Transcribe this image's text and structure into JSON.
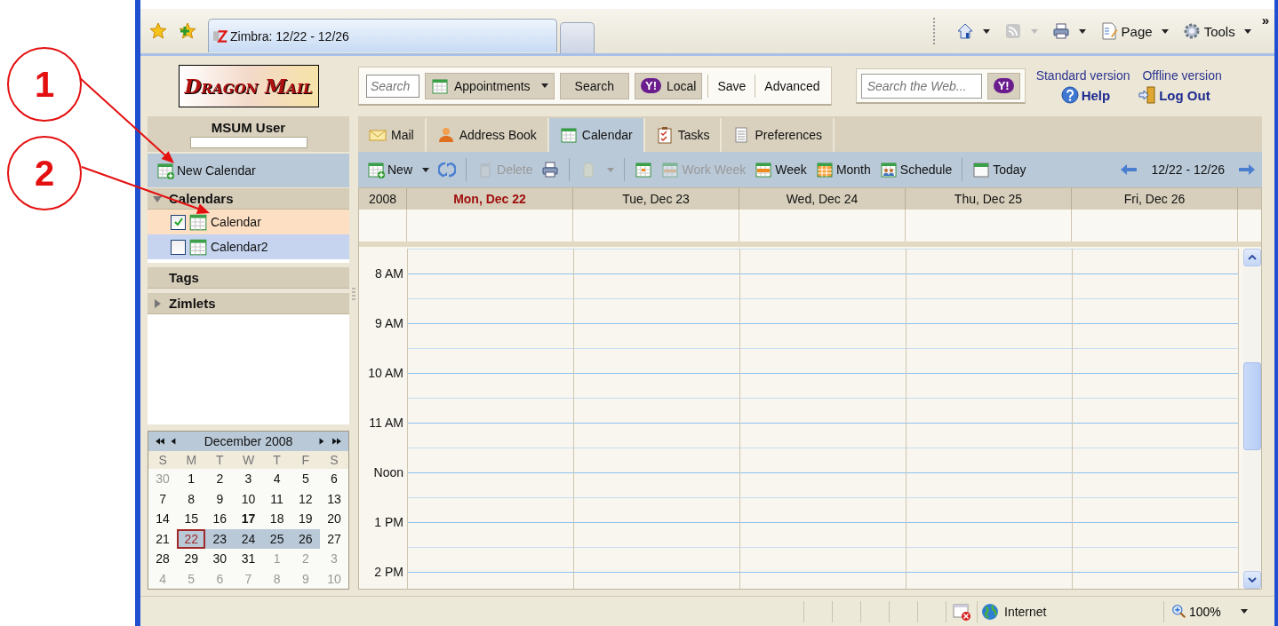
{
  "annotations": [
    {
      "label": "1"
    },
    {
      "label": "2"
    }
  ],
  "browser": {
    "tab_title": "Zimbra: 12/22 - 12/26",
    "commands": [
      {
        "kind": "home",
        "dropdown": true,
        "disabled": false
      },
      {
        "kind": "feeds",
        "dropdown": true,
        "disabled": true
      },
      {
        "kind": "print",
        "dropdown": true,
        "disabled": false
      },
      {
        "kind": "page",
        "label": "Page",
        "dropdown": true,
        "disabled": false
      },
      {
        "kind": "tools",
        "label": "Tools",
        "dropdown": true,
        "disabled": false
      }
    ],
    "overflow": "»"
  },
  "header": {
    "logo": "Dragon Mail",
    "search": {
      "placeholder": "Search",
      "type": "Appointments",
      "button": "Search",
      "local": {
        "mark": "Y!",
        "label": "Local"
      },
      "links": [
        "Save",
        "Advanced"
      ]
    },
    "web_search": {
      "placeholder": "Search the Web...",
      "mark": "Y!"
    },
    "links": [
      "Standard version",
      "Offline version"
    ],
    "actions": [
      {
        "kind": "help",
        "label": "Help"
      },
      {
        "kind": "logout",
        "label": "Log Out"
      }
    ]
  },
  "sidebar": {
    "user": "MSUM User",
    "new_calendar": "New Calendar",
    "sections": [
      {
        "kind": "tree",
        "label": "Calendars",
        "expanded": true,
        "items": [
          {
            "label": "Calendar",
            "checked": true,
            "color": "#fde0c4"
          },
          {
            "label": "Calendar2",
            "checked": false,
            "color": "#c6d4f0"
          }
        ]
      },
      {
        "kind": "header",
        "label": "Tags"
      },
      {
        "kind": "tree",
        "label": "Zimlets",
        "expanded": false
      }
    ]
  },
  "mini_calendar": {
    "title": "December 2008",
    "weekdays": [
      "S",
      "M",
      "T",
      "W",
      "T",
      "F",
      "S"
    ],
    "weeks": [
      [
        {
          "label": "30",
          "muted": true,
          "today": false,
          "selected": false,
          "focused": false
        },
        {
          "label": "1",
          "muted": false,
          "today": false,
          "selected": false,
          "focused": false
        },
        {
          "label": "2",
          "muted": false,
          "today": false,
          "selected": false,
          "focused": false
        },
        {
          "label": "3",
          "muted": false,
          "today": false,
          "selected": false,
          "focused": false
        },
        {
          "label": "4",
          "muted": false,
          "today": false,
          "selected": false,
          "focused": false
        },
        {
          "label": "5",
          "muted": false,
          "today": false,
          "selected": false,
          "focused": false
        },
        {
          "label": "6",
          "muted": false,
          "today": false,
          "selected": false,
          "focused": false
        }
      ],
      [
        {
          "label": "7",
          "muted": false,
          "today": false,
          "selected": false,
          "focused": false
        },
        {
          "label": "8",
          "muted": false,
          "today": false,
          "selected": false,
          "focused": false
        },
        {
          "label": "9",
          "muted": false,
          "today": false,
          "selected": false,
          "focused": false
        },
        {
          "label": "10",
          "muted": false,
          "today": false,
          "selected": false,
          "focused": false
        },
        {
          "label": "11",
          "muted": false,
          "today": false,
          "selected": false,
          "focused": false
        },
        {
          "label": "12",
          "muted": false,
          "today": false,
          "selected": false,
          "focused": false
        },
        {
          "label": "13",
          "muted": false,
          "today": false,
          "selected": false,
          "focused": false
        }
      ],
      [
        {
          "label": "14",
          "muted": false,
          "today": false,
          "selected": false,
          "focused": false
        },
        {
          "label": "15",
          "muted": false,
          "today": false,
          "selected": false,
          "focused": false
        },
        {
          "label": "16",
          "muted": false,
          "today": false,
          "selected": false,
          "focused": false
        },
        {
          "label": "17",
          "muted": false,
          "today": true,
          "selected": false,
          "focused": false
        },
        {
          "label": "18",
          "muted": false,
          "today": false,
          "selected": false,
          "focused": false
        },
        {
          "label": "19",
          "muted": false,
          "today": false,
          "selected": false,
          "focused": false
        },
        {
          "label": "20",
          "muted": false,
          "today": false,
          "selected": false,
          "focused": false
        }
      ],
      [
        {
          "label": "21",
          "muted": false,
          "today": false,
          "selected": false,
          "focused": false
        },
        {
          "label": "22",
          "muted": false,
          "today": false,
          "selected": true,
          "focused": true
        },
        {
          "label": "23",
          "muted": false,
          "today": false,
          "selected": true,
          "focused": false
        },
        {
          "label": "24",
          "muted": false,
          "today": false,
          "selected": true,
          "focused": false
        },
        {
          "label": "25",
          "muted": false,
          "today": false,
          "selected": true,
          "focused": false
        },
        {
          "label": "26",
          "muted": false,
          "today": false,
          "selected": true,
          "focused": false
        },
        {
          "label": "27",
          "muted": false,
          "today": false,
          "selected": false,
          "focused": false
        }
      ],
      [
        {
          "label": "28",
          "muted": false,
          "today": false,
          "selected": false,
          "focused": false
        },
        {
          "label": "29",
          "muted": false,
          "today": false,
          "selected": false,
          "focused": false
        },
        {
          "label": "30",
          "muted": false,
          "today": false,
          "selected": false,
          "focused": false
        },
        {
          "label": "31",
          "muted": false,
          "today": false,
          "selected": false,
          "focused": false
        },
        {
          "label": "1",
          "muted": true,
          "today": false,
          "selected": false,
          "focused": false
        },
        {
          "label": "2",
          "muted": true,
          "today": false,
          "selected": false,
          "focused": false
        },
        {
          "label": "3",
          "muted": true,
          "today": false,
          "selected": false,
          "focused": false
        }
      ],
      [
        {
          "label": "4",
          "muted": true,
          "today": false,
          "selected": false,
          "focused": false
        },
        {
          "label": "5",
          "muted": true,
          "today": false,
          "selected": false,
          "focused": false
        },
        {
          "label": "6",
          "muted": true,
          "today": false,
          "selected": false,
          "focused": false
        },
        {
          "label": "7",
          "muted": true,
          "today": false,
          "selected": false,
          "focused": false
        },
        {
          "label": "8",
          "muted": true,
          "today": false,
          "selected": false,
          "focused": false
        },
        {
          "label": "9",
          "muted": true,
          "today": false,
          "selected": false,
          "focused": false
        },
        {
          "label": "10",
          "muted": true,
          "today": false,
          "selected": false,
          "focused": false
        }
      ]
    ]
  },
  "app_tabs": [
    {
      "kind": "mail",
      "label": "Mail",
      "selected": false
    },
    {
      "kind": "contacts",
      "label": "Address Book",
      "selected": false
    },
    {
      "kind": "calendar",
      "label": "Calendar",
      "selected": true
    },
    {
      "kind": "tasks",
      "label": "Tasks",
      "selected": false
    },
    {
      "kind": "preferences",
      "label": "Preferences",
      "selected": false
    }
  ],
  "toolbar": {
    "items": [
      {
        "kind": "new",
        "label": "New",
        "dropdown": true,
        "disabled": false
      },
      {
        "kind": "refresh",
        "disabled": false
      },
      {
        "kind": "separator"
      },
      {
        "kind": "delete",
        "label": "Delete",
        "disabled": true
      },
      {
        "kind": "print",
        "disabled": false
      },
      {
        "kind": "separator"
      },
      {
        "kind": "tag",
        "dropdown": true,
        "disabled": true
      },
      {
        "kind": "separator"
      },
      {
        "kind": "day",
        "disabled": false
      },
      {
        "kind": "workweek",
        "label": "Work Week",
        "disabled": true
      },
      {
        "kind": "week",
        "label": "Week",
        "disabled": false
      },
      {
        "kind": "month",
        "label": "Month",
        "disabled": false
      },
      {
        "kind": "schedule",
        "label": "Schedule",
        "disabled": false
      },
      {
        "kind": "separator"
      },
      {
        "kind": "today",
        "label": "Today",
        "disabled": false
      }
    ],
    "range": "12/22 - 12/26"
  },
  "week_view": {
    "year": "2008",
    "days": [
      {
        "label": "Mon, Dec 22",
        "today": true
      },
      {
        "label": "Tue, Dec 23",
        "today": false
      },
      {
        "label": "Wed, Dec 24",
        "today": false
      },
      {
        "label": "Thu, Dec 25",
        "today": false
      },
      {
        "label": "Fri, Dec 26",
        "today": false
      }
    ],
    "hours": [
      "8 AM",
      "9 AM",
      "10 AM",
      "11 AM",
      "Noon",
      "1 PM",
      "2 PM"
    ]
  },
  "status_bar": {
    "zone": "Internet",
    "zoom": "100%"
  }
}
